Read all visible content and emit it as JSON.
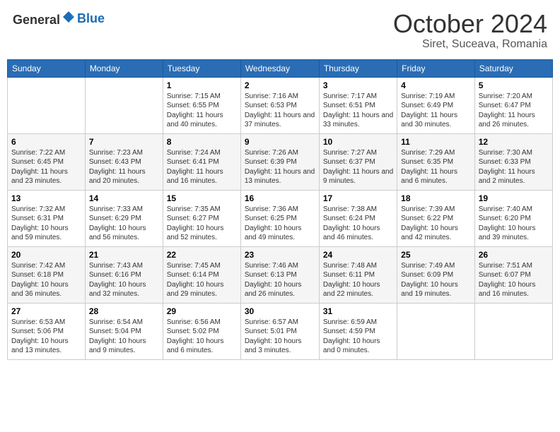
{
  "header": {
    "logo_general": "General",
    "logo_blue": "Blue",
    "month": "October 2024",
    "location": "Siret, Suceava, Romania"
  },
  "days_of_week": [
    "Sunday",
    "Monday",
    "Tuesday",
    "Wednesday",
    "Thursday",
    "Friday",
    "Saturday"
  ],
  "weeks": [
    [
      {
        "day": "",
        "info": ""
      },
      {
        "day": "",
        "info": ""
      },
      {
        "day": "1",
        "info": "Sunrise: 7:15 AM\nSunset: 6:55 PM\nDaylight: 11 hours and 40 minutes."
      },
      {
        "day": "2",
        "info": "Sunrise: 7:16 AM\nSunset: 6:53 PM\nDaylight: 11 hours and 37 minutes."
      },
      {
        "day": "3",
        "info": "Sunrise: 7:17 AM\nSunset: 6:51 PM\nDaylight: 11 hours and 33 minutes."
      },
      {
        "day": "4",
        "info": "Sunrise: 7:19 AM\nSunset: 6:49 PM\nDaylight: 11 hours and 30 minutes."
      },
      {
        "day": "5",
        "info": "Sunrise: 7:20 AM\nSunset: 6:47 PM\nDaylight: 11 hours and 26 minutes."
      }
    ],
    [
      {
        "day": "6",
        "info": "Sunrise: 7:22 AM\nSunset: 6:45 PM\nDaylight: 11 hours and 23 minutes."
      },
      {
        "day": "7",
        "info": "Sunrise: 7:23 AM\nSunset: 6:43 PM\nDaylight: 11 hours and 20 minutes."
      },
      {
        "day": "8",
        "info": "Sunrise: 7:24 AM\nSunset: 6:41 PM\nDaylight: 11 hours and 16 minutes."
      },
      {
        "day": "9",
        "info": "Sunrise: 7:26 AM\nSunset: 6:39 PM\nDaylight: 11 hours and 13 minutes."
      },
      {
        "day": "10",
        "info": "Sunrise: 7:27 AM\nSunset: 6:37 PM\nDaylight: 11 hours and 9 minutes."
      },
      {
        "day": "11",
        "info": "Sunrise: 7:29 AM\nSunset: 6:35 PM\nDaylight: 11 hours and 6 minutes."
      },
      {
        "day": "12",
        "info": "Sunrise: 7:30 AM\nSunset: 6:33 PM\nDaylight: 11 hours and 2 minutes."
      }
    ],
    [
      {
        "day": "13",
        "info": "Sunrise: 7:32 AM\nSunset: 6:31 PM\nDaylight: 10 hours and 59 minutes."
      },
      {
        "day": "14",
        "info": "Sunrise: 7:33 AM\nSunset: 6:29 PM\nDaylight: 10 hours and 56 minutes."
      },
      {
        "day": "15",
        "info": "Sunrise: 7:35 AM\nSunset: 6:27 PM\nDaylight: 10 hours and 52 minutes."
      },
      {
        "day": "16",
        "info": "Sunrise: 7:36 AM\nSunset: 6:25 PM\nDaylight: 10 hours and 49 minutes."
      },
      {
        "day": "17",
        "info": "Sunrise: 7:38 AM\nSunset: 6:24 PM\nDaylight: 10 hours and 46 minutes."
      },
      {
        "day": "18",
        "info": "Sunrise: 7:39 AM\nSunset: 6:22 PM\nDaylight: 10 hours and 42 minutes."
      },
      {
        "day": "19",
        "info": "Sunrise: 7:40 AM\nSunset: 6:20 PM\nDaylight: 10 hours and 39 minutes."
      }
    ],
    [
      {
        "day": "20",
        "info": "Sunrise: 7:42 AM\nSunset: 6:18 PM\nDaylight: 10 hours and 36 minutes."
      },
      {
        "day": "21",
        "info": "Sunrise: 7:43 AM\nSunset: 6:16 PM\nDaylight: 10 hours and 32 minutes."
      },
      {
        "day": "22",
        "info": "Sunrise: 7:45 AM\nSunset: 6:14 PM\nDaylight: 10 hours and 29 minutes."
      },
      {
        "day": "23",
        "info": "Sunrise: 7:46 AM\nSunset: 6:13 PM\nDaylight: 10 hours and 26 minutes."
      },
      {
        "day": "24",
        "info": "Sunrise: 7:48 AM\nSunset: 6:11 PM\nDaylight: 10 hours and 22 minutes."
      },
      {
        "day": "25",
        "info": "Sunrise: 7:49 AM\nSunset: 6:09 PM\nDaylight: 10 hours and 19 minutes."
      },
      {
        "day": "26",
        "info": "Sunrise: 7:51 AM\nSunset: 6:07 PM\nDaylight: 10 hours and 16 minutes."
      }
    ],
    [
      {
        "day": "27",
        "info": "Sunrise: 6:53 AM\nSunset: 5:06 PM\nDaylight: 10 hours and 13 minutes."
      },
      {
        "day": "28",
        "info": "Sunrise: 6:54 AM\nSunset: 5:04 PM\nDaylight: 10 hours and 9 minutes."
      },
      {
        "day": "29",
        "info": "Sunrise: 6:56 AM\nSunset: 5:02 PM\nDaylight: 10 hours and 6 minutes."
      },
      {
        "day": "30",
        "info": "Sunrise: 6:57 AM\nSunset: 5:01 PM\nDaylight: 10 hours and 3 minutes."
      },
      {
        "day": "31",
        "info": "Sunrise: 6:59 AM\nSunset: 4:59 PM\nDaylight: 10 hours and 0 minutes."
      },
      {
        "day": "",
        "info": ""
      },
      {
        "day": "",
        "info": ""
      }
    ]
  ]
}
